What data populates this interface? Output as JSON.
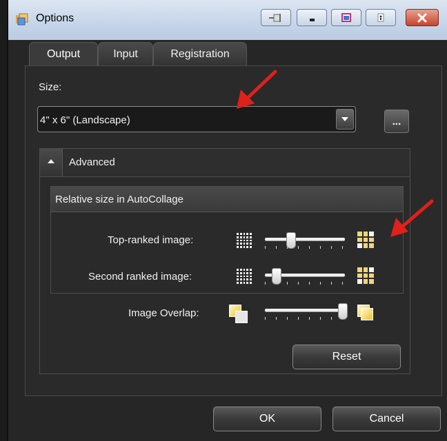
{
  "window": {
    "title": "Options",
    "titlebar_buttons": [
      "pin-icon",
      "minimize-icon",
      "restore-icon",
      "help-icon",
      "close-icon"
    ]
  },
  "tabs": [
    {
      "label": "Output",
      "active": true
    },
    {
      "label": "Input",
      "active": false
    },
    {
      "label": "Registration",
      "active": false
    }
  ],
  "output": {
    "size_label": "Size:",
    "size_value": "4\" x 6\" (Landscape)",
    "more_label": "...",
    "advanced": {
      "title": "Advanced",
      "relative_size_group": {
        "title": "Relative size in AutoCollage",
        "sliders": [
          {
            "label": "Top-ranked image:",
            "value_fraction": 0.3
          },
          {
            "label": "Second ranked image:",
            "value_fraction": 0.1
          }
        ]
      },
      "overlap": {
        "label": "Image Overlap:",
        "value_fraction": 1.0
      },
      "reset_label": "Reset"
    }
  },
  "footer": {
    "ok_label": "OK",
    "cancel_label": "Cancel"
  },
  "colors": {
    "background": "#262626",
    "annotation_arrow": "#e0201b",
    "accent_gold": "#f1d57a"
  }
}
